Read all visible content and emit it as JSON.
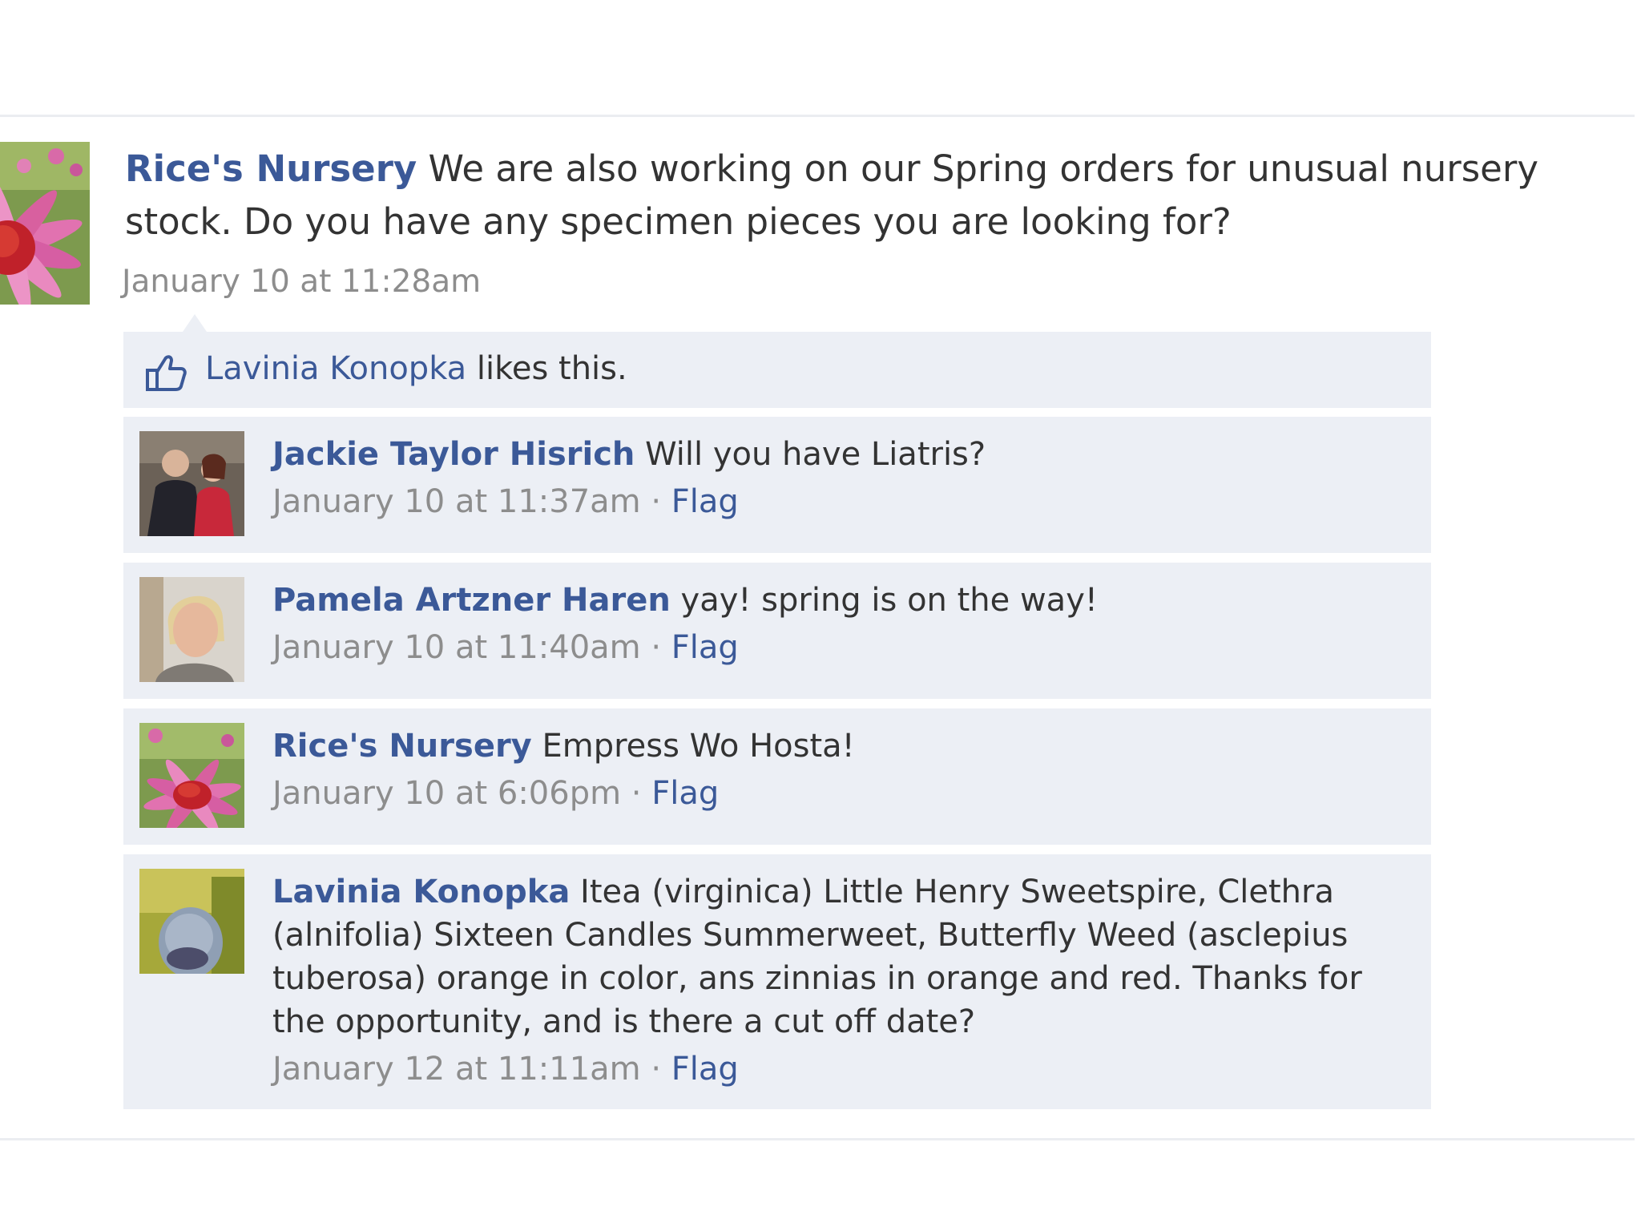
{
  "post": {
    "author": "Rice's Nursery",
    "text": "We are also working on our Spring orders for unusual nursery stock. Do you have any specimen pieces you are looking for?",
    "timestamp": "January 10 at 11:28am",
    "avatar_icon": "coneflower-avatar"
  },
  "likes": {
    "icon": "thumbs-up-icon",
    "name": "Lavinia Konopka",
    "suffix": "likes this."
  },
  "comments": [
    {
      "author": "Jackie Taylor Hisrich",
      "text": "Will you have Liatris?",
      "timestamp": "January 10 at 11:37am",
      "separator": "·",
      "flag": "Flag",
      "avatar_icon": "couple-photo-avatar"
    },
    {
      "author": "Pamela Artzner Haren",
      "text": "yay! spring is on the way!",
      "timestamp": "January 10 at 11:40am",
      "separator": "·",
      "flag": "Flag",
      "avatar_icon": "woman-photo-avatar"
    },
    {
      "author": "Rice's Nursery",
      "text": "Empress Wo Hosta!",
      "timestamp": "January 10 at 6:06pm",
      "separator": "·",
      "flag": "Flag",
      "avatar_icon": "coneflower-avatar"
    },
    {
      "author": "Lavinia Konopka",
      "text": "Itea (virginica) Little Henry Sweetspire, Clethra (alnifolia) Sixteen Candles Summerweet, Butterfly Weed (asclepius tuberosa) orange in color, ans zinnias in orange and red. Thanks for the opportunity, and is there a cut off date?",
      "timestamp": "January 12 at 11:11am",
      "separator": "·",
      "flag": "Flag",
      "avatar_icon": "person-photo-avatar"
    }
  ],
  "colors": {
    "link": "#3b5998",
    "comment_bg": "#eceff5",
    "meta_gray": "#8d8d8d",
    "text": "#333333"
  }
}
